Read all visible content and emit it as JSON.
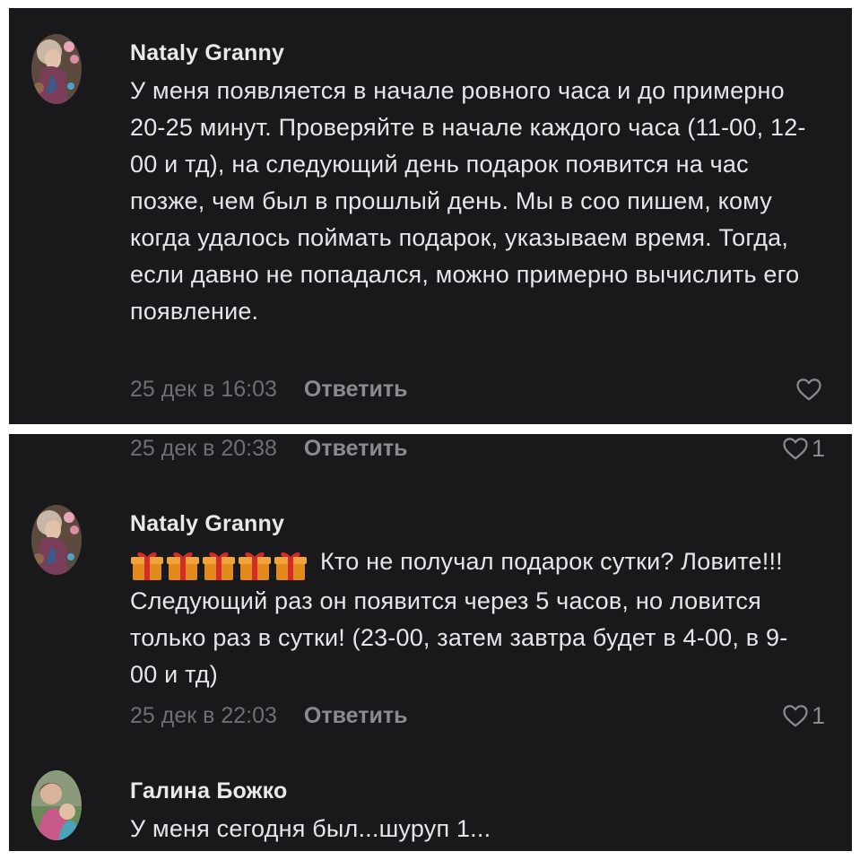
{
  "comments_top": [
    {
      "author": "Nataly Granny",
      "text": "У меня появляется в начале ровного часа и до примерно 20-25 минут. Проверяйте в начале каждого часа (11-00, 12-00 и тд), на следующий день подарок появится на час позже, чем был в прошлый день. Мы в соо пишем, кому когда удалось поймать подарок, указываем время. Тогда, если давно не попадался, можно примерно вычислить его появление.",
      "timestamp": "25 дек в 16:03",
      "reply_label": "Ответить",
      "likes": ""
    }
  ],
  "comments_bottom": [
    {
      "author": "",
      "text": "",
      "timestamp": "25 дек в 20:38",
      "reply_label": "Ответить",
      "likes": "1"
    },
    {
      "author": "Nataly Granny",
      "gift_icons": [
        "gift-icon",
        "gift-icon",
        "gift-icon",
        "gift-icon",
        "gift-icon"
      ],
      "text": "Кто не получал подарок сутки? Ловите!!! Следующий раз он появится через 5 часов, но ловится только раз в сутки! (23-00, затем завтра будет в 4-00, в 9-00 и тд)",
      "timestamp": "25 дек в 22:03",
      "reply_label": "Ответить",
      "likes": "1"
    },
    {
      "author": "Галина Божко",
      "text": "У меня сегодня был...шуруп 1...",
      "timestamp": "",
      "reply_label": "",
      "likes": ""
    }
  ],
  "colors": {
    "panel_background": "#19191b",
    "frame_background": "#ffffff",
    "author_text": "#e9e9ec",
    "body_text": "#e6e6ea",
    "meta_text": "#6e6e73",
    "reply_text": "#8a8a8f"
  }
}
